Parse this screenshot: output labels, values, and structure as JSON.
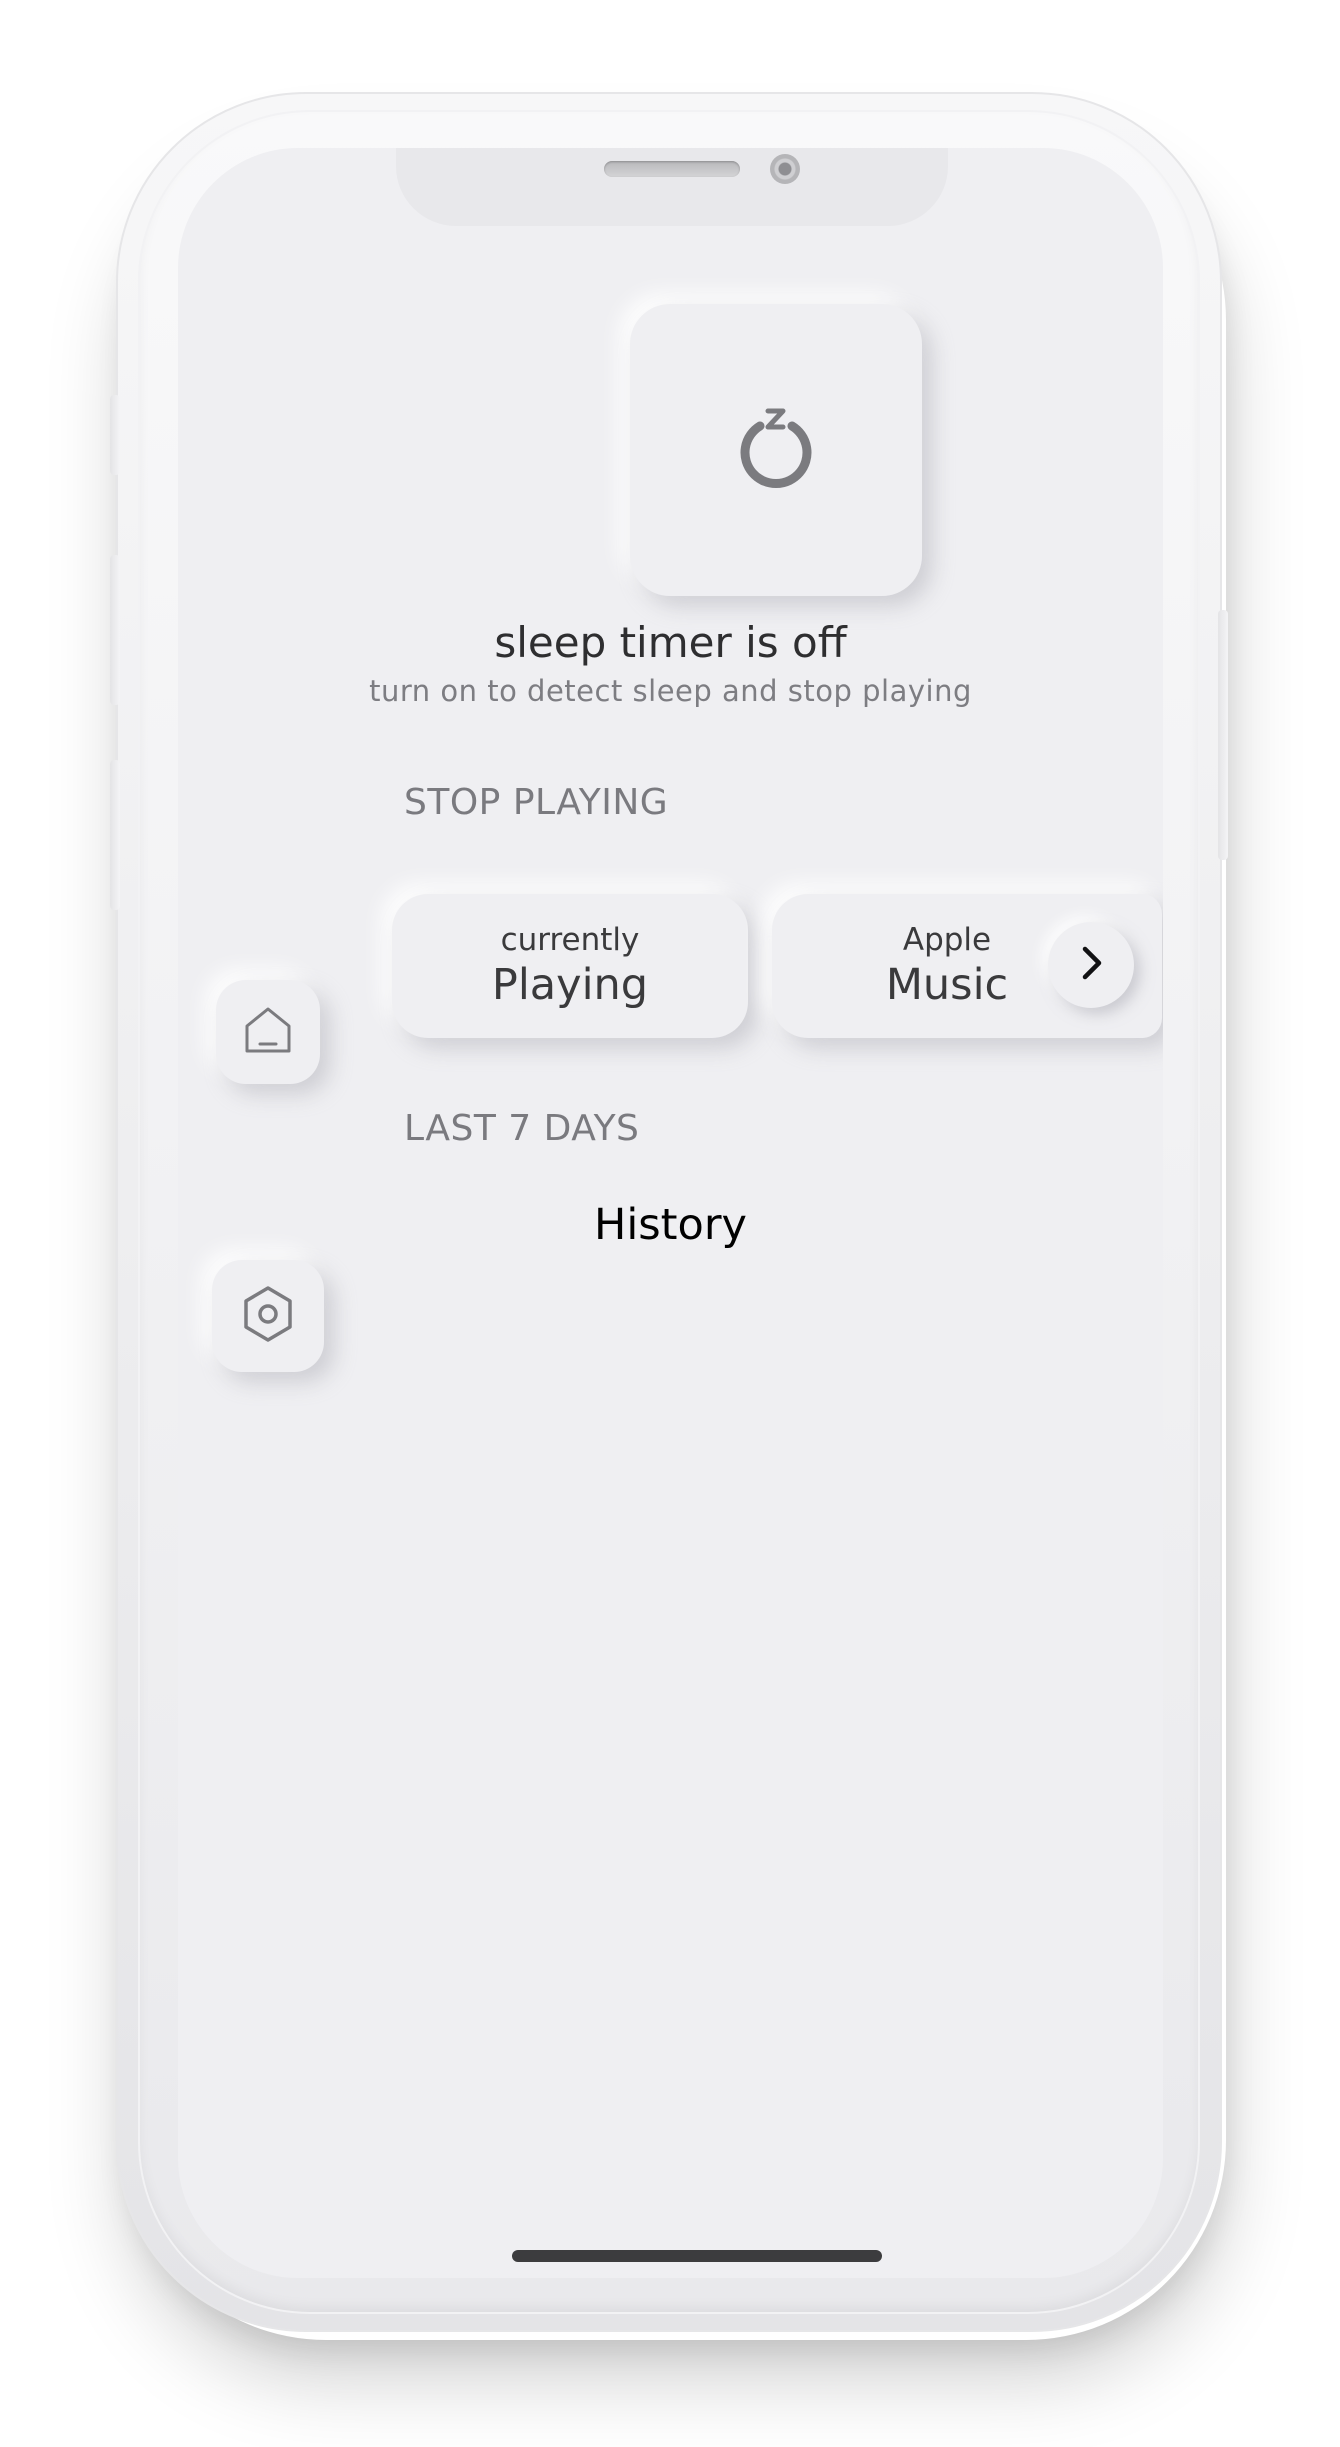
{
  "sleep_timer": {
    "icon": "sleep-power-icon",
    "title": "sleep timer is off",
    "subtitle": "turn on to detect sleep and stop playing"
  },
  "stop_playing": {
    "heading": "STOP PLAYING",
    "sources": [
      {
        "top": "currently",
        "main": "Playing"
      },
      {
        "top": "Apple",
        "main": "Music"
      }
    ],
    "next_icon": "chevron-right-icon"
  },
  "history": {
    "heading": "LAST 7 DAYS",
    "label": "History"
  },
  "side_nav": [
    {
      "icon": "home-icon"
    },
    {
      "icon": "settings-icon"
    }
  ],
  "colors": {
    "screen_bg": "#efeff2",
    "icon_gray": "#7b7b7f",
    "text_dark": "#2e2e30"
  }
}
